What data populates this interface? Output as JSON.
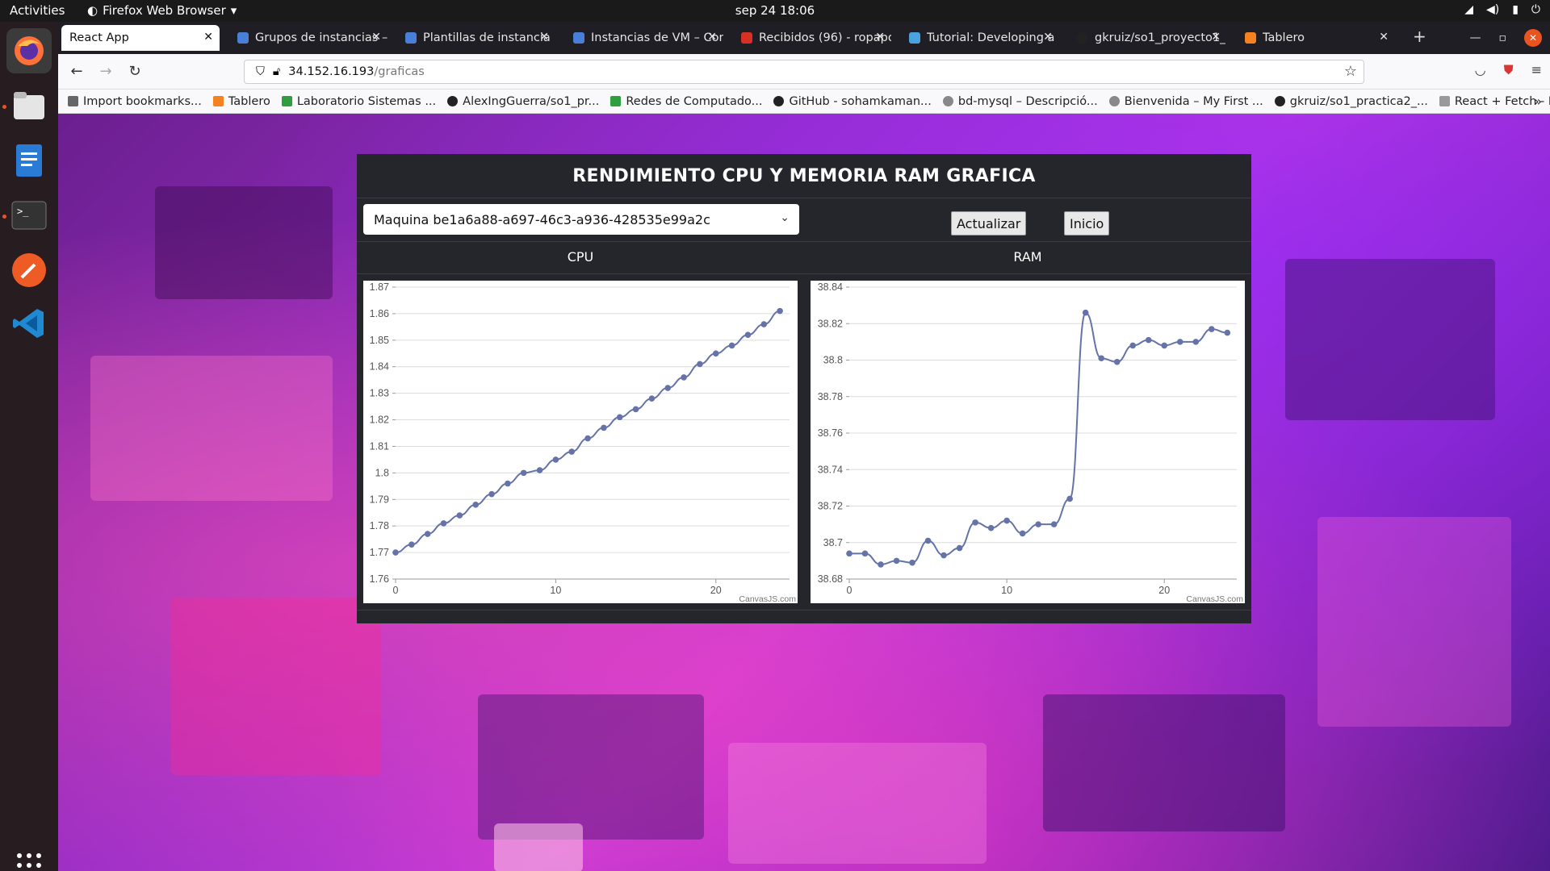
{
  "system": {
    "activities": "Activities",
    "app_name": "Firefox Web Browser",
    "clock": "sep 24  18:06"
  },
  "browser": {
    "tabs": [
      {
        "label": "React App",
        "active": true
      },
      {
        "label": "Grupos de instancias –",
        "active": false
      },
      {
        "label": "Plantillas de instancia",
        "active": false
      },
      {
        "label": "Instancias de VM – Con",
        "active": false
      },
      {
        "label": "Recibidos (96) - ropapo",
        "active": false
      },
      {
        "label": "Tutorial: Developing a",
        "active": false
      },
      {
        "label": "gkruiz/so1_proyecto1_",
        "active": false
      },
      {
        "label": "Tablero",
        "active": false
      }
    ],
    "url_host": "34.152.16.193",
    "url_path": "/graficas",
    "bookmarks": [
      "Import bookmarks...",
      "Tablero",
      "Laboratorio Sistemas ...",
      "AlexIngGuerra/so1_pr...",
      "Redes de Computado...",
      "GitHub - sohamkaman...",
      "bd-mysql – Descripció...",
      "Bienvenida – My First ...",
      "gkruiz/so1_practica2_...",
      "React + Fetch - HTTP ..."
    ]
  },
  "page": {
    "title": "RENDIMIENTO CPU Y MEMORIA RAM GRAFICA",
    "machine_select": "Maquina be1a6a88-a697-46c3-a936-428535e99a2c",
    "refresh_button": "Actualizar",
    "home_button": "Inicio",
    "cpu_label": "CPU",
    "ram_label": "RAM",
    "credit": "CanvasJS.com"
  },
  "chart_data": [
    {
      "type": "line",
      "title": "CPU",
      "color": "#6673a8",
      "ylim": [
        1.76,
        1.87
      ],
      "yticks": [
        "1.76",
        "1.77",
        "1.78",
        "1.79",
        "1.8",
        "1.81",
        "1.82",
        "1.83",
        "1.84",
        "1.85",
        "1.86",
        "1.87"
      ],
      "xlim": [
        0,
        24
      ],
      "xticks": [
        "0",
        "10",
        "20"
      ],
      "x": [
        0,
        1,
        2,
        3,
        4,
        5,
        6,
        7,
        8,
        9,
        10,
        11,
        12,
        13,
        14,
        15,
        16,
        17,
        18,
        19,
        20,
        21,
        22,
        23,
        24
      ],
      "y": [
        1.77,
        1.773,
        1.777,
        1.781,
        1.784,
        1.788,
        1.792,
        1.796,
        1.8,
        1.801,
        1.805,
        1.808,
        1.813,
        1.817,
        1.821,
        1.824,
        1.828,
        1.832,
        1.836,
        1.841,
        1.845,
        1.848,
        1.852,
        1.856,
        1.861
      ]
    },
    {
      "type": "line",
      "title": "RAM",
      "color": "#6673a8",
      "ylim": [
        38.68,
        38.84
      ],
      "yticks": [
        "38.68",
        "38.7",
        "38.72",
        "38.74",
        "38.76",
        "38.78",
        "38.8",
        "38.82",
        "38.84"
      ],
      "xlim": [
        0,
        24
      ],
      "xticks": [
        "0",
        "10",
        "20"
      ],
      "x": [
        0,
        1,
        2,
        3,
        4,
        5,
        6,
        7,
        8,
        9,
        10,
        11,
        12,
        13,
        14,
        15,
        16,
        17,
        18,
        19,
        20,
        21,
        22,
        23,
        24
      ],
      "y": [
        38.694,
        38.694,
        38.688,
        38.69,
        38.689,
        38.701,
        38.693,
        38.697,
        38.711,
        38.708,
        38.712,
        38.705,
        38.71,
        38.71,
        38.724,
        38.826,
        38.801,
        38.799,
        38.808,
        38.811,
        38.808,
        38.81,
        38.81,
        38.817,
        38.815
      ]
    }
  ]
}
